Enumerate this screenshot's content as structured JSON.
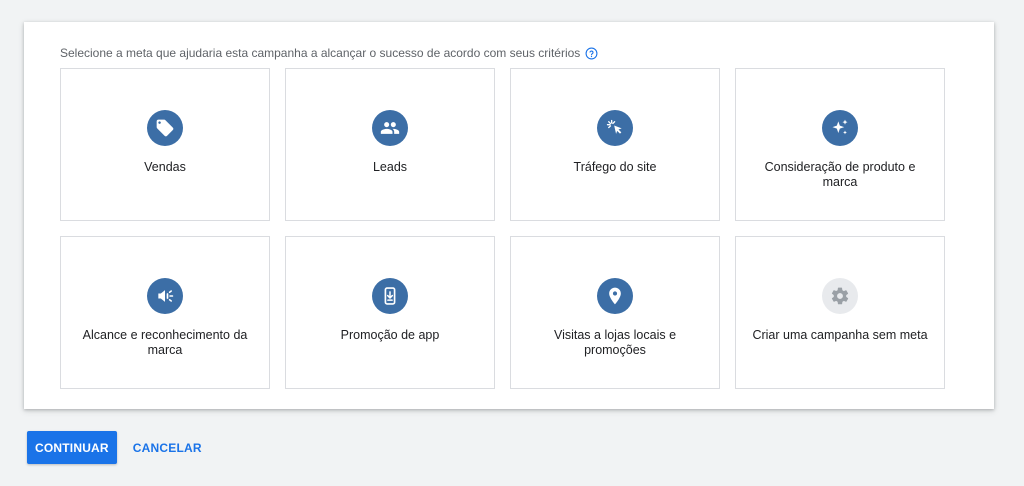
{
  "prompt": {
    "text": "Selecione a meta que ajudaria esta campanha a alcançar o sucesso de acordo com seus critérios",
    "help_icon": "help-circle-icon"
  },
  "goals": [
    {
      "label": "Vendas",
      "icon": "tag-icon"
    },
    {
      "label": "Leads",
      "icon": "people-icon"
    },
    {
      "label": "Tráfego do site",
      "icon": "cursor-click-icon"
    },
    {
      "label": "Consideração de produto e marca",
      "icon": "sparkle-icon"
    },
    {
      "label": "Alcance e reconhecimento da marca",
      "icon": "megaphone-icon"
    },
    {
      "label": "Promoção de app",
      "icon": "phone-download-icon"
    },
    {
      "label": "Visitas a lojas locais e promoções",
      "icon": "location-pin-icon"
    },
    {
      "label": "Criar uma campanha sem meta",
      "icon": "gear-icon"
    }
  ],
  "footer": {
    "continue_label": "CONTINUAR",
    "cancel_label": "CANCELAR"
  },
  "colors": {
    "accent": "#1a73e8",
    "icon_circle": "#3c6ea6",
    "icon_circle_disabled": "#e8eaed",
    "background": "#f1f3f4"
  }
}
